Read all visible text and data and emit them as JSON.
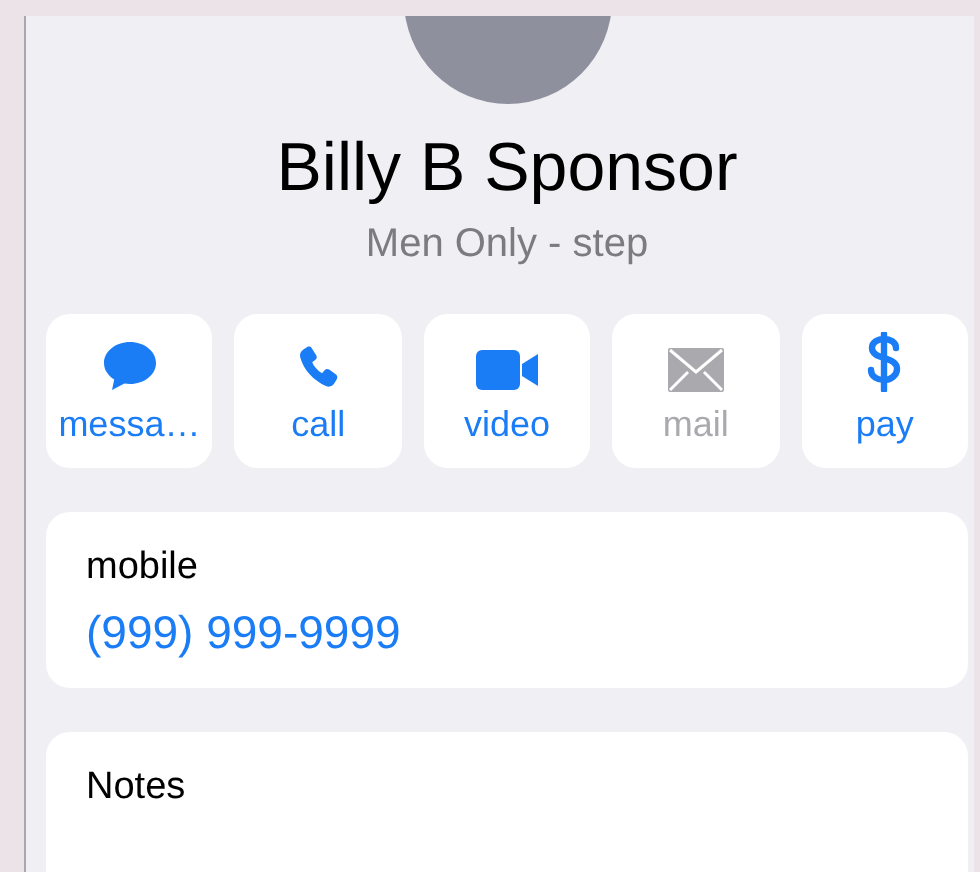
{
  "contact": {
    "name": "Billy B Sponsor",
    "subtitle": "Men Only - step"
  },
  "actions": [
    {
      "kind": "message",
      "label": "messa…",
      "disabled": false
    },
    {
      "kind": "call",
      "label": "call",
      "disabled": false
    },
    {
      "kind": "video",
      "label": "video",
      "disabled": false
    },
    {
      "kind": "mail",
      "label": "mail",
      "disabled": true
    },
    {
      "kind": "pay",
      "label": "pay",
      "disabled": false
    }
  ],
  "phone": {
    "label": "mobile",
    "number": "(999) 999-9999"
  },
  "notes": {
    "label": "Notes"
  }
}
